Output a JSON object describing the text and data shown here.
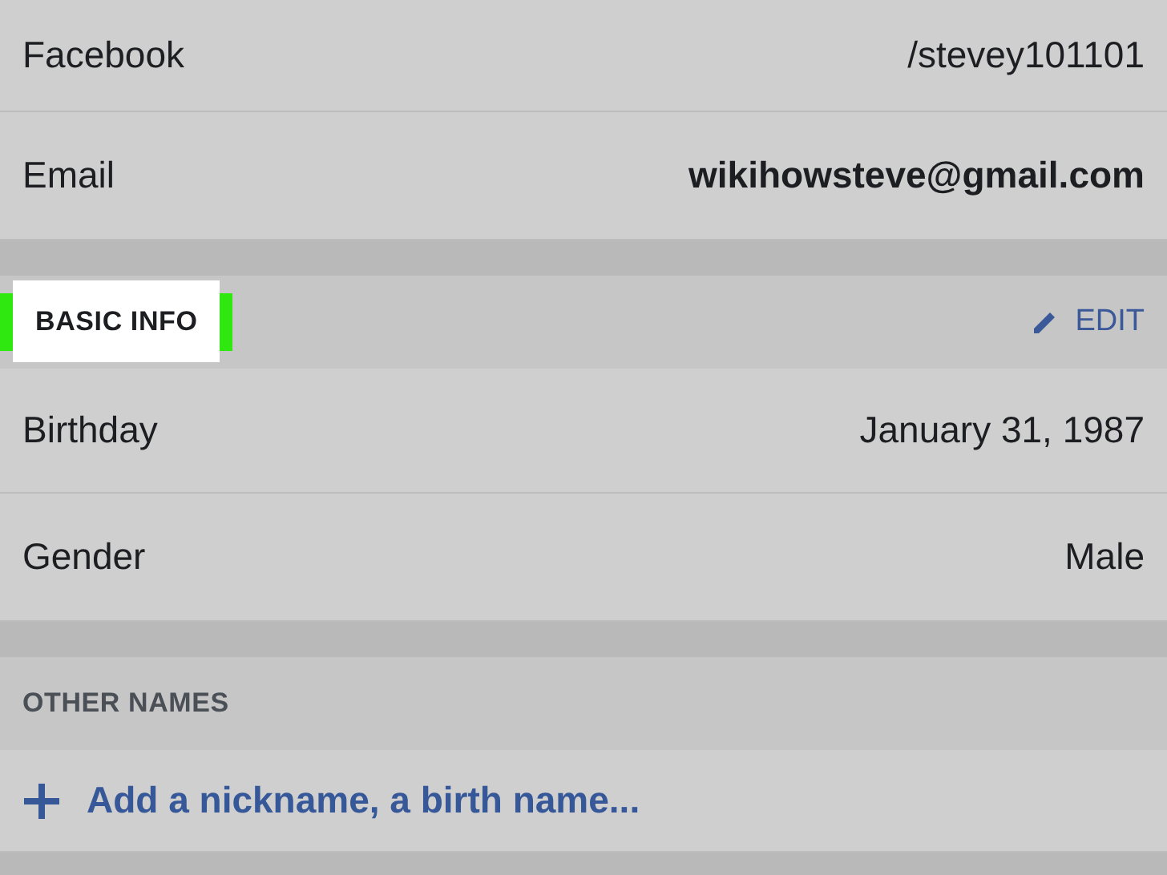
{
  "contact_rows": [
    {
      "label": "Facebook",
      "value": "/stevey101101",
      "bold": false
    },
    {
      "label": "Email",
      "value": "wikihowsteve@gmail.com",
      "bold": true
    }
  ],
  "basic_info": {
    "title": "BASIC INFO",
    "highlighted": true,
    "edit": "EDIT",
    "rows": [
      {
        "label": "Birthday",
        "value": "January 31, 1987"
      },
      {
        "label": "Gender",
        "value": "Male"
      }
    ]
  },
  "other_names": {
    "title": "OTHER NAMES",
    "add_link": "Add a nickname, a birth name..."
  }
}
